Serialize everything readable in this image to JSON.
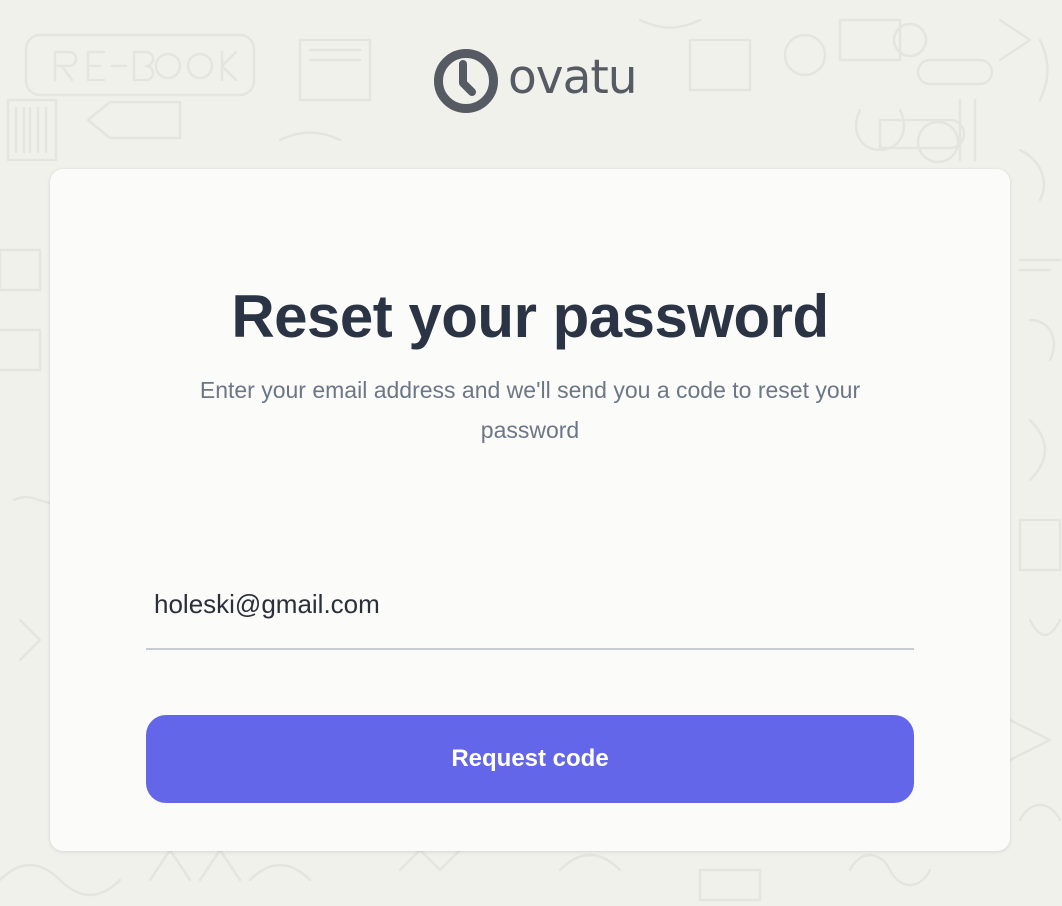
{
  "brand": {
    "name": "ovatu",
    "logo_icon": "clock-icon",
    "text_color": "#565a63"
  },
  "reset": {
    "title": "Reset your password",
    "subtitle": "Enter your email address and we'll send you a code to reset your password"
  },
  "email": {
    "value": "holeski@gmail.com"
  },
  "request_button": {
    "label": "Request code",
    "color": "#6366e9"
  },
  "colors": {
    "background": "#f1f1ec",
    "card": "#fbfbf9",
    "title": "#2b3444",
    "subtitle": "#6c7686"
  }
}
